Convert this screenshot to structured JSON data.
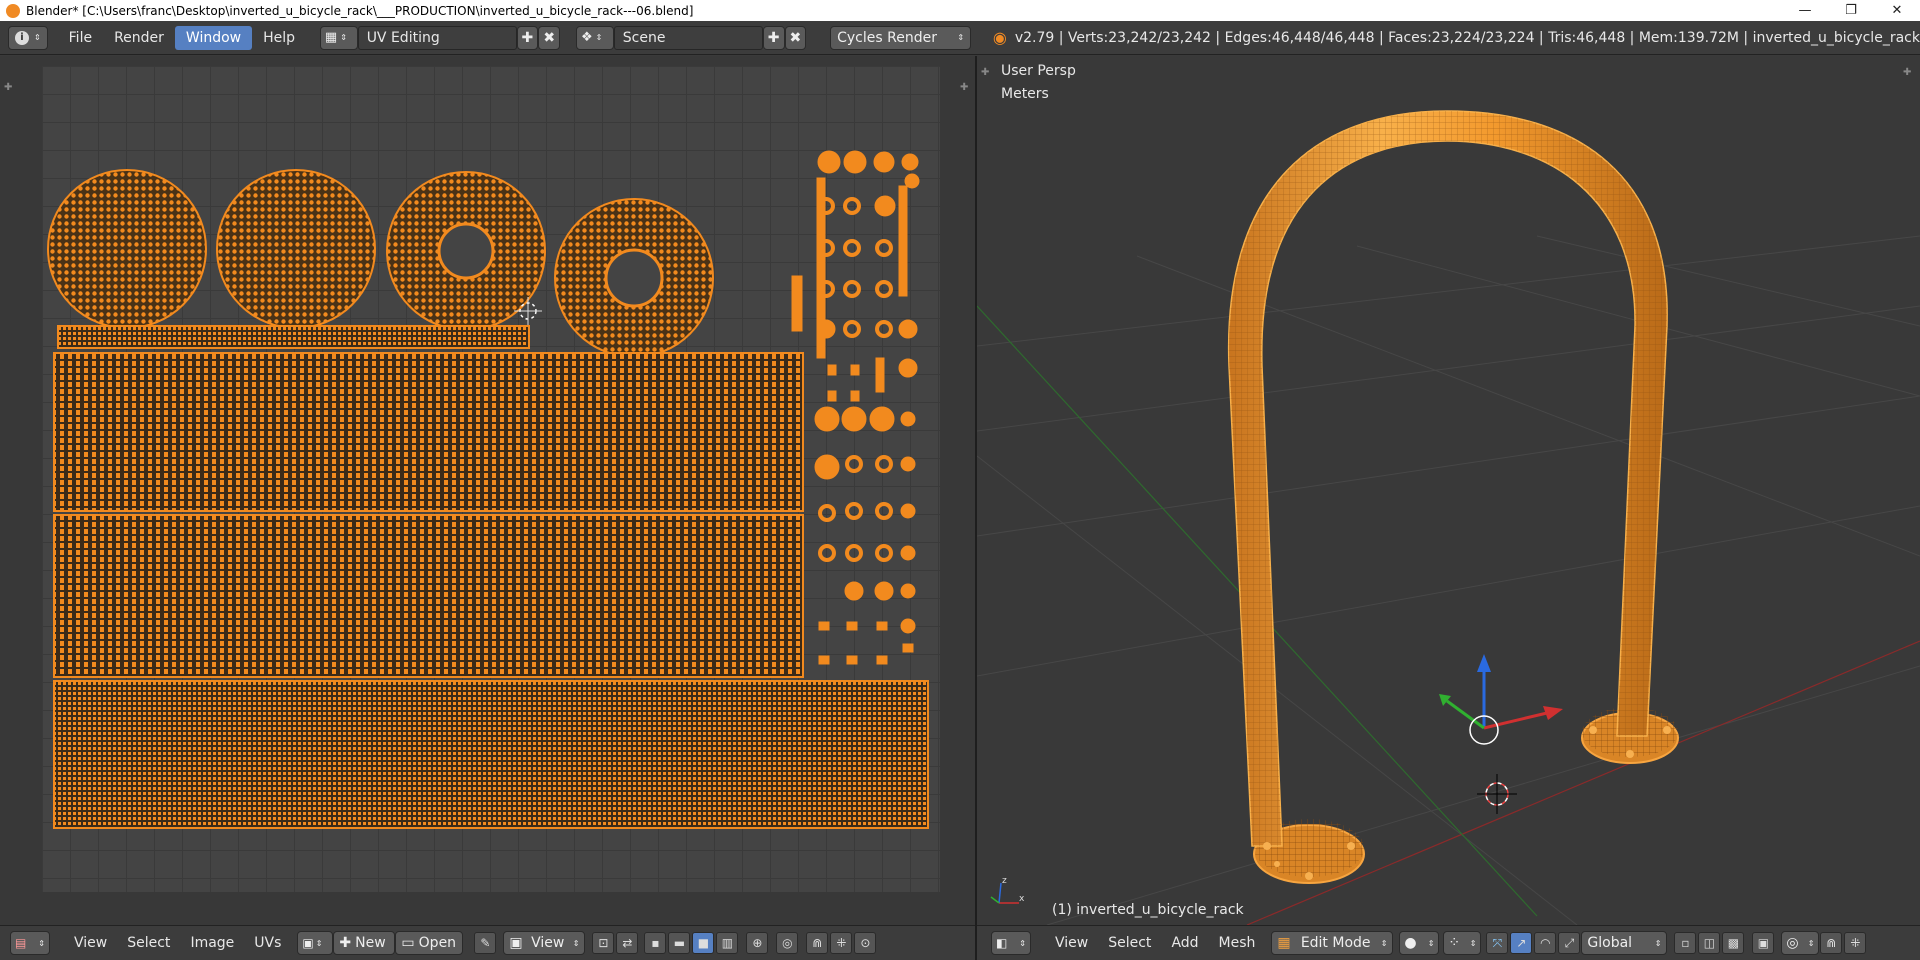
{
  "window": {
    "title": "Blender* [C:\\Users\\franc\\Desktop\\inverted_u_bicycle_rack\\___PRODUCTION\\inverted_u_bicycle_rack---06.blend]",
    "minimize": "—",
    "maximize": "❐",
    "close": "✕"
  },
  "info_header": {
    "editor_icon": "i",
    "menus": [
      "File",
      "Render",
      "Window",
      "Help"
    ],
    "active_menu": "Window",
    "screen_layout": "UV Editing",
    "scene": "Scene",
    "render_engine": "Cycles Render",
    "stats": "v2.79 | Verts:23,242/23,242 | Edges:46,448/46,448 | Faces:23,224/23,224 | Tris:46,448 | Mem:139.72M | inverted_u_bicycle_rack"
  },
  "viewport": {
    "view_name": "User Persp",
    "units": "Meters",
    "object_label": "(1) inverted_u_bicycle_rack",
    "mesh_color": "#f39a2e",
    "grid_color": "#4a4a4a"
  },
  "uv_editor": {
    "uv_color": "#f28a1e",
    "background": "#444444"
  },
  "uv_header": {
    "menus": [
      "View",
      "Select",
      "Image",
      "UVs"
    ],
    "new_label": "New",
    "open_label": "Open",
    "view_label": "View"
  },
  "view3d_header": {
    "menus": [
      "View",
      "Select",
      "Add",
      "Mesh"
    ],
    "mode": "Edit Mode",
    "orientation": "Global"
  },
  "colors": {
    "accent": "#5680c2",
    "orange": "#f28a1e"
  }
}
